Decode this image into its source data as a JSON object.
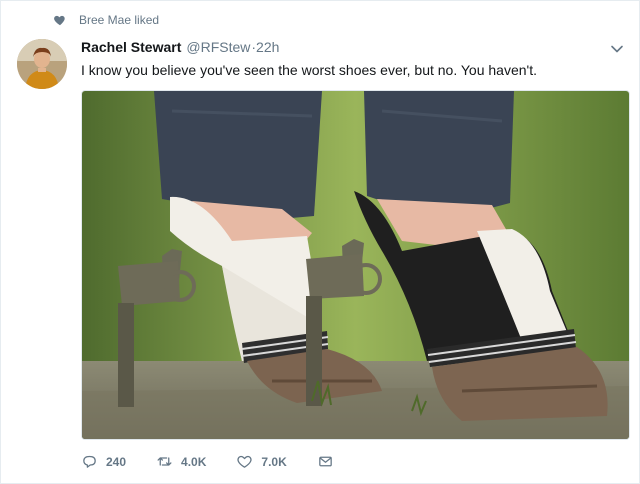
{
  "context": {
    "icon": "heart-icon",
    "text": "Bree Mae liked"
  },
  "tweet": {
    "author_name": "Rachel Stewart",
    "handle": "@RFStew",
    "separator": "·",
    "time": "22h",
    "text": "I know you believe you've seen the worst shoes ever, but no. You haven't."
  },
  "actions": {
    "reply_count": "240",
    "retweet_count": "4.0K",
    "like_count": "7.0K"
  },
  "icons": [
    "heart-icon",
    "avatar",
    "chevron-down-icon",
    "reply-icon",
    "retweet-icon",
    "like-icon",
    "message-icon"
  ],
  "colors": {
    "secondary_text": "#657786",
    "primary_text": "#14171a",
    "border": "#e6ecf0"
  }
}
